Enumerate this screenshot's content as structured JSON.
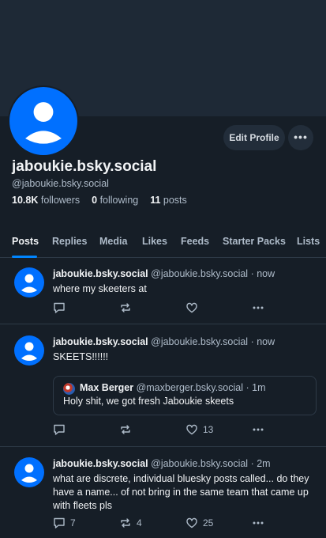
{
  "profile": {
    "display_name": "jaboukie.bsky.social",
    "handle": "@jaboukie.bsky.social",
    "followers_count": "10.8K",
    "followers_label": "followers",
    "following_count": "0",
    "following_label": "following",
    "posts_count": "11",
    "posts_label": "posts",
    "edit_label": "Edit Profile",
    "more_label": "•••"
  },
  "tabs": [
    {
      "label": "Posts",
      "active": true
    },
    {
      "label": "Replies"
    },
    {
      "label": "Media"
    },
    {
      "label": "Likes"
    },
    {
      "label": "Feeds"
    },
    {
      "label": "Starter Packs"
    },
    {
      "label": "Lists"
    }
  ],
  "posts": [
    {
      "name": "jaboukie.bsky.social",
      "handle": "@jaboukie.bsky.social",
      "time": "· now",
      "text": "where my skeeters at",
      "replies": "",
      "reposts": "",
      "likes": ""
    },
    {
      "name": "jaboukie.bsky.social",
      "handle": "@jaboukie.bsky.social",
      "time": "· now",
      "text": "SKEETS!!!!!!",
      "quote": {
        "name": "Max Berger",
        "handle": "@maxberger.bsky.social",
        "time": "· 1m",
        "text": "Holy shit, we got fresh Jaboukie skeets"
      },
      "replies": "",
      "reposts": "",
      "likes": "13"
    },
    {
      "name": "jaboukie.bsky.social",
      "handle": "@jaboukie.bsky.social",
      "time": "· 2m",
      "text": "what are discrete, individual bluesky posts called... do they have a name... of not  bring in the same team that came up with fleets pls",
      "replies": "7",
      "reposts": "4",
      "likes": "25"
    }
  ],
  "colors": {
    "background": "#161e27",
    "banner": "#1e2936",
    "accent": "#0085ff",
    "avatar": "#0070ff"
  },
  "icons": [
    "reply-icon",
    "repost-icon",
    "like-icon",
    "more-icon",
    "default-avatar-icon"
  ]
}
